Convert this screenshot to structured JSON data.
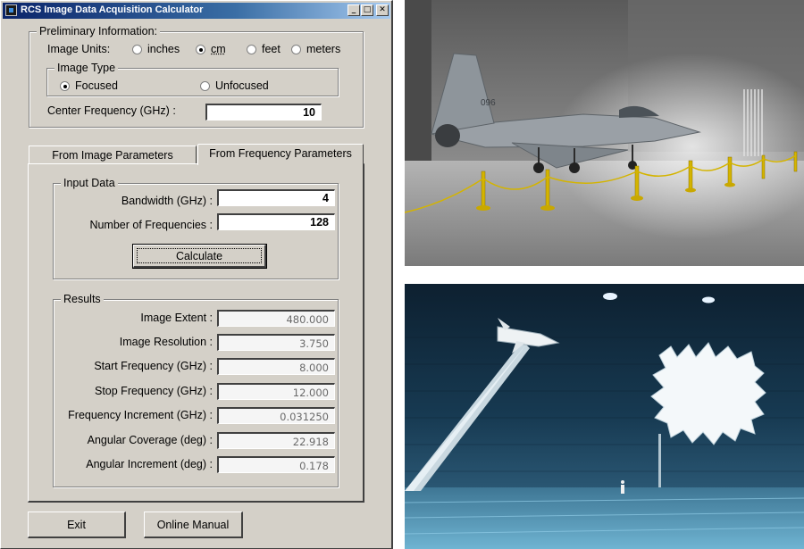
{
  "window": {
    "title": "RCS Image Data Acquisition Calculator",
    "min": "_",
    "max": "□",
    "close": "✕"
  },
  "preliminary": {
    "legend": "Preliminary Information:",
    "units_label": "Image Units:",
    "units": [
      {
        "label": "inches",
        "selected": false
      },
      {
        "label": "cm",
        "selected": true
      },
      {
        "label": "feet",
        "selected": false
      },
      {
        "label": "meters",
        "selected": false
      }
    ],
    "image_type": {
      "legend": "Image Type",
      "options": [
        {
          "label": "Focused",
          "selected": true
        },
        {
          "label": "Unfocused",
          "selected": false
        }
      ]
    },
    "center_freq_label": "Center Frequency (GHz) :",
    "center_freq_value": "10"
  },
  "tabs": [
    {
      "label": "From Image Parameters",
      "active": false
    },
    {
      "label": "From Frequency Parameters",
      "active": true
    }
  ],
  "input_data": {
    "legend": "Input Data",
    "bandwidth_label": "Bandwidth (GHz) :",
    "bandwidth_value": "4",
    "nfreq_label": "Number of Frequencies :",
    "nfreq_value": "128",
    "calculate_label": "Calculate"
  },
  "results": {
    "legend": "Results",
    "rows": [
      {
        "label": "Image Extent :",
        "value": "480.000"
      },
      {
        "label": "Image Resolution :",
        "value": "3.750"
      },
      {
        "label": "Start Frequency (GHz) :",
        "value": "8.000"
      },
      {
        "label": "Stop Frequency (GHz) :",
        "value": "12.000"
      },
      {
        "label": "Frequency Increment (GHz) :",
        "value": "0.031250"
      },
      {
        "label": "Angular Coverage (deg) :",
        "value": "22.918"
      },
      {
        "label": "Angular Increment (deg) :",
        "value": "0.178"
      }
    ]
  },
  "buttons": {
    "exit": "Exit",
    "manual": "Online Manual"
  }
}
